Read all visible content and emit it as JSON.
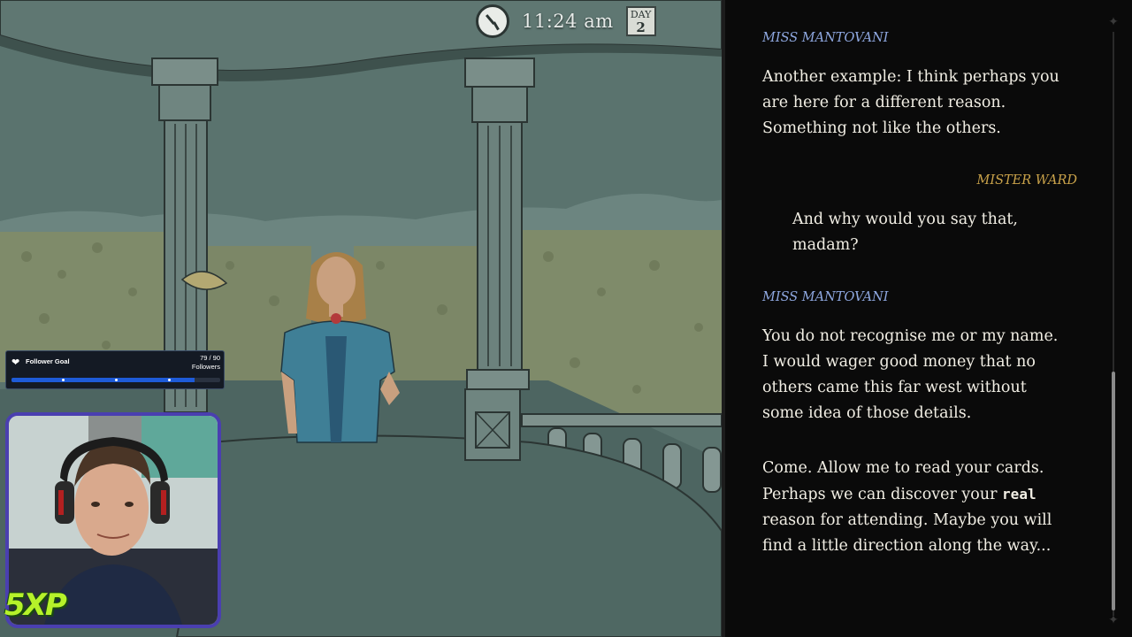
{
  "hud": {
    "time": "11:24 am",
    "day_label": "DAY",
    "day_number": "2",
    "clock_icon": "clock-icon"
  },
  "follower_goal": {
    "title": "Follower Goal",
    "count": "79 / 90",
    "unit": "Followers",
    "progress_fraction": 0.878,
    "icon": "heart-icon"
  },
  "stream_logo": "5XP",
  "dialogue": [
    {
      "speaker": "MISS MANTOVANI",
      "text": "Another example: I think perhaps you are here for a different reason. Something not like the others."
    },
    {
      "speaker": "MISTER WARD",
      "text": "And why would you say that, madam?"
    },
    {
      "speaker": "MISS MANTOVANI",
      "text": "You do not recognise me or my name. I would wager good money that no others came this far west without some idea of those details."
    },
    {
      "speaker": "",
      "text_before": "Come. Allow me to read your cards. Perhaps we can discover your ",
      "text_emph": "real",
      "text_after": " reason for attending. Maybe you will find a little direction along the way..."
    }
  ],
  "colors": {
    "miss_mantovani": "#8fa8e0",
    "mister_ward": "#c9a24a",
    "dialogue_text": "#f1eee4",
    "panel_bg": "#0a0a0a",
    "webcam_border": "#4a3fb0",
    "logo_green": "#b6f22a"
  }
}
